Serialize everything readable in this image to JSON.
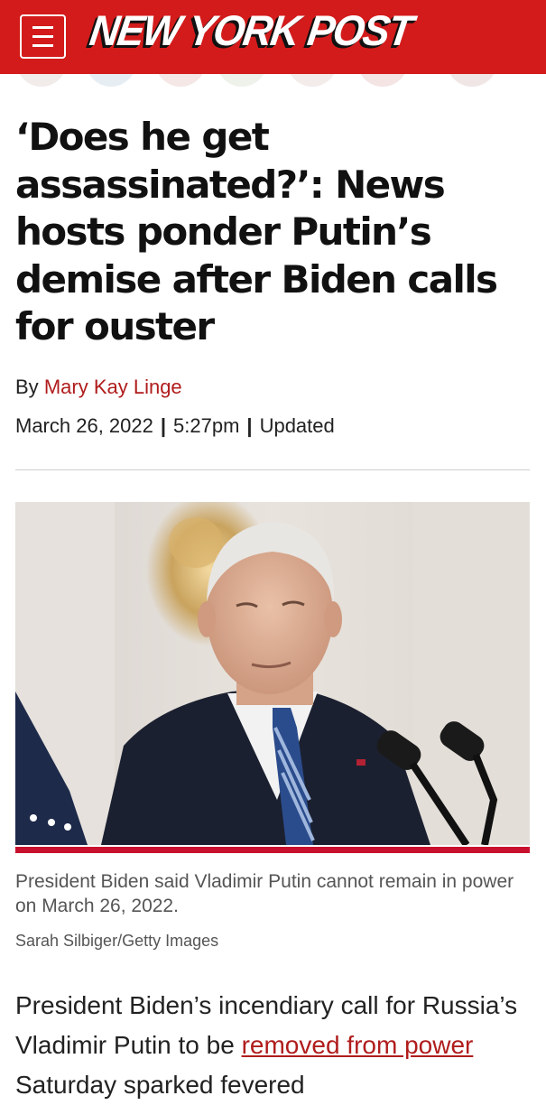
{
  "header": {
    "logo_text": "NEW YORK POST",
    "menu_icon": "hamburger-menu-icon",
    "background_color": "#d31b1b"
  },
  "article": {
    "headline": "‘Does he get assassinated?’: News hosts ponder Putin’s demise after Biden calls for ouster",
    "byline_prefix": "By",
    "author": "Mary Kay Linge",
    "date": "March 26, 2022",
    "time": "5:27pm",
    "updated_label": "Updated",
    "image_caption": "President Biden said Vladimir Putin cannot remain in power on March 26, 2022.",
    "image_credit": "Sarah Silbiger/Getty Images",
    "body_part1": "President Biden’s incendiary call for Russia’s Vladimir Putin to be ",
    "body_link": "removed from power",
    "body_part2": " Saturday sparked fevered"
  },
  "colors": {
    "accent": "#d31b1b",
    "link": "#b01c1c",
    "caption_bar": "#c8102e"
  }
}
